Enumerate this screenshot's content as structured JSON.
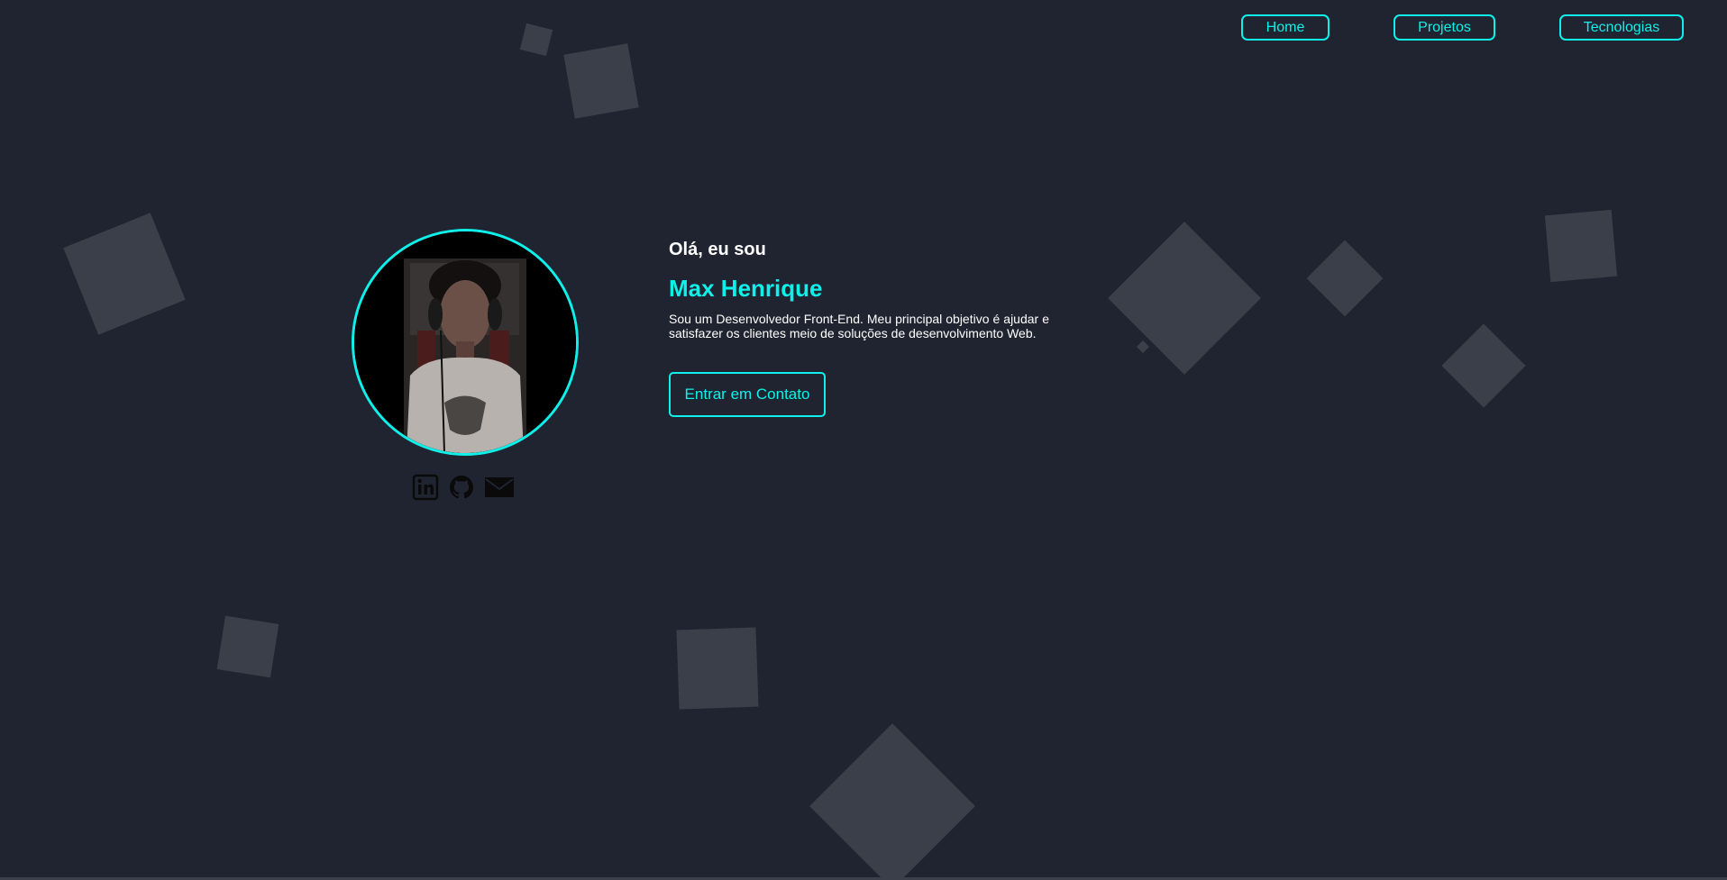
{
  "nav": {
    "items": [
      {
        "label": "Home"
      },
      {
        "label": "Projetos"
      },
      {
        "label": "Tecnologias"
      }
    ]
  },
  "hero": {
    "greeting": "Olá, eu sou",
    "name": "Max Henrique",
    "description": "Sou um Desenvolvedor Front-End. Meu principal objetivo é ajudar e satisfazer os clientes meio de soluções de desenvolvimento Web.",
    "cta_label": "Entrar em Contato"
  },
  "social": {
    "icons": [
      "linkedin-icon",
      "github-icon",
      "email-icon"
    ]
  },
  "colors": {
    "background": "#1f2430",
    "accent": "#0ff0ea",
    "decor_square": "#3b3f4a",
    "text": "#ffffff"
  }
}
